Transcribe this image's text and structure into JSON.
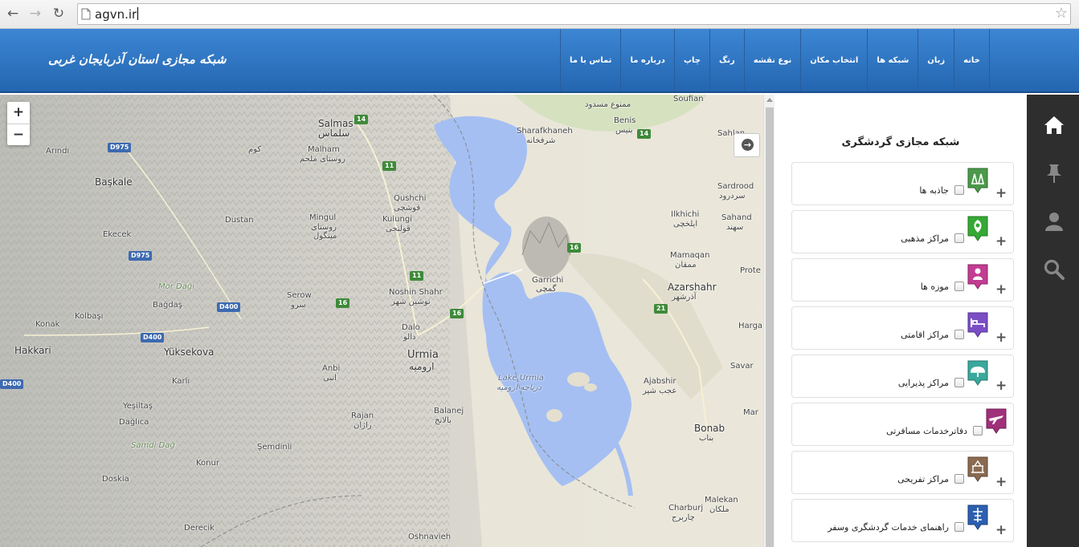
{
  "browser": {
    "url": "agvn.ir",
    "back_icon": "back-arrow-icon",
    "forward_icon": "forward-arrow-icon",
    "reload_icon": "reload-icon",
    "bookmark_icon": "star-icon"
  },
  "header": {
    "title": "شبکه مجازی استان آذربایجان غربی",
    "menu": [
      "خانه",
      "زبان",
      "شبکه ها",
      "انتخاب مکان",
      "نوع نقشه",
      "رنگ",
      "چاپ",
      "درباره ما",
      "تماس با ما"
    ],
    "bg_color": "#2d74c4"
  },
  "map": {
    "zoom_in": "+",
    "zoom_out": "−",
    "labels": {
      "salmas_en": "Salmas",
      "salmas_fa": "سلماس",
      "malham_en": "Malham",
      "malham_fa": "روستای ملحم",
      "mingul_en": "Mingul",
      "mingul_fa": "روستای",
      "mingul_fa2": "مینگول",
      "kulungi_en": "Kulungi",
      "kulungi_fa": "قولنجی",
      "qushchi_en": "Qushchi",
      "qushchi_fa": "قوشچی",
      "noshin_en": "Noshin Shahr",
      "noshin_fa": "نوشین شهر",
      "serow_en": "Serow",
      "serow_fa": "سرو",
      "dalo_en": "Dalo",
      "dalo_fa": "دالو",
      "urmia_en": "Urmia",
      "urmia_fa": "ارومیه",
      "anbi_en": "Anbi",
      "anbi_fa": "انبی",
      "balanej_en": "Balanej",
      "balanej_fa": "بالانج",
      "rajan_en": "Rajan",
      "rajan_fa": "راژان",
      "lake_en": "Lake Urmia",
      "lake_fa": "دریاچه ارومیه",
      "garrichi_en": "Garrichi",
      "garrichi_fa": "گمچی",
      "sharafkhaneh_en": "Sharafkhaneh",
      "sharafkhaneh_fa": "شرفخانه",
      "benis_en": "Benis",
      "benis_fa": "بنیس",
      "ilkhichi_en": "Ilkhichi",
      "ilkhichi_fa": "ایلخچی",
      "sardrood_en": "Sardrood",
      "sardrood_fa": "سردرود",
      "sahand_en": "Sahand",
      "sahand_fa": "سهند",
      "mamaqan_en": "Mamaqan",
      "mamaqan_fa": "ممقان",
      "azarshahr_en": "Azarshahr",
      "azarshahr_fa": "آذرشهر",
      "ajabshir_en": "Ajabshir",
      "ajabshir_fa": "عجب شیر",
      "bonab_en": "Bonab",
      "bonab_fa": "بناب",
      "malekan_en": "Malekan",
      "malekan_fa": "ملکان",
      "charburj_en": "Charburj",
      "charburj_fa": "چاربرج",
      "oshnavieh_en": "Oshnavieh",
      "arindi": "Arındı",
      "baskale": "Başkale",
      "ekecek": "Ekecek",
      "dustan": "Dustan",
      "mordagi": "Mor Dağı",
      "bagdas": "Bağdaş",
      "konak": "Konak",
      "kolbasi": "Kolbaşı",
      "hakkari": "Hakkari",
      "yuksekova": "Yüksekova",
      "karli": "Karlı",
      "yesiltas": "Yeşiltaş",
      "daglica": "Dağlıca",
      "samdidag": "Samdi Dağ",
      "semdinli": "Şemdinli",
      "konur": "Konur",
      "doskia": "Doskia",
      "derecik": "Derecik",
      "sahlan": "Sahlan",
      "soufian": "Soufian",
      "hargar": "Harga",
      "savar": "Savar",
      "mar": "Mar",
      "prote": "Prote",
      "kom": "کوم",
      "mamnou": "ممنوع مسدود"
    },
    "roads": {
      "r14a": "14",
      "r14b": "14",
      "r11a": "11",
      "r11b": "11",
      "r16a": "16",
      "r16b": "16",
      "r16c": "16",
      "r21": "21",
      "d975a": "D975",
      "d975b": "D975",
      "d400a": "D400",
      "d400b": "D400",
      "d400c": "D400"
    },
    "water_color": "#a5bff2",
    "land_color": "#ece8dc"
  },
  "panel": {
    "title": "شبکه مجازی گردشگری",
    "categories": [
      {
        "name": "جاذبه ها",
        "icon": "attractions-icon",
        "color": "#4a9a4a"
      },
      {
        "name": "مراکز مذهبی",
        "icon": "religious-centers-icon",
        "color": "#35a835"
      },
      {
        "name": "موزه ها",
        "icon": "museums-icon",
        "color": "#c23c92"
      },
      {
        "name": "مراکز اقامتی",
        "icon": "accommodation-icon",
        "color": "#7b4fc4"
      },
      {
        "name": "مراکز پذیرایی",
        "icon": "restaurants-icon",
        "color": "#3aa89c"
      },
      {
        "name": "دفاترخدمات مسافرتی",
        "icon": "travel-agencies-icon",
        "color": "#a0307a"
      },
      {
        "name": "مراکز تفریحی",
        "icon": "recreation-icon",
        "color": "#8a6a50"
      },
      {
        "name": "راهنمای خدمات گردشگری وسفر",
        "icon": "travel-guide-icon",
        "color": "#2c5fb0"
      }
    ],
    "plus": "+"
  },
  "sidebar": {
    "icons": [
      "home-icon",
      "pin-icon",
      "user-icon",
      "search-icon"
    ]
  }
}
